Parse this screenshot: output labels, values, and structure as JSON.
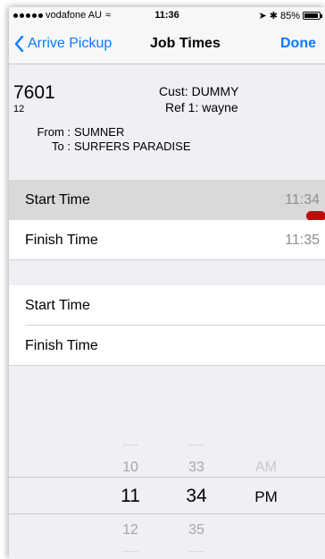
{
  "status_bar": {
    "carrier": "vodafone AU",
    "time": "11:36",
    "battery": "85%",
    "battery_fraction": 0.85
  },
  "nav": {
    "back_label": "Arrive Pickup",
    "title": "Job Times",
    "done_label": "Done"
  },
  "job": {
    "number": "7601",
    "sub_number": "12",
    "customer_label": "Cust:",
    "customer": "DUMMY",
    "ref_label": "Ref 1:",
    "ref": "wayne",
    "from_label": "From :",
    "from": "SUMNER",
    "to_label": "To :",
    "to": "SURFERS PARADISE"
  },
  "section1": {
    "start_label": "Start Time",
    "start_value": "11:34",
    "finish_label": "Finish Time",
    "finish_value": "11:35"
  },
  "section2": {
    "start_label": "Start Time",
    "start_value": "",
    "finish_label": "Finish Time",
    "finish_value": ""
  },
  "picker": {
    "hours": [
      "10",
      "11",
      "12"
    ],
    "minutes": [
      "33",
      "34",
      "35"
    ],
    "ampm": [
      "AM",
      "PM"
    ],
    "selected": {
      "hour": "11",
      "minute": "34",
      "ampm": "PM"
    }
  },
  "colors": {
    "accent": "#0a7aff",
    "marker": "#c20a0a",
    "selected_row": "#d9d9d9"
  }
}
